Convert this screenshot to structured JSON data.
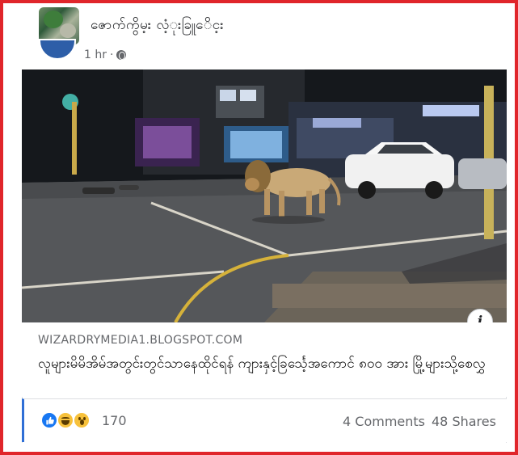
{
  "page": {
    "name": "ဇောက်ကွိမ့း လံ့ုးခြူေိင့း"
  },
  "post": {
    "time": "1 hr",
    "link_domain": "WIZARDRYMEDIA1.BLOGSPOT.COM",
    "link_headline": "လူများမိမိအိမ်အတွင်းတွင်သာနေထိုင်ရန် ကျားနှင့်ခြင်္သေ့အကောင် ၈၀၀ အား မြို့များသို့စေလွှ"
  },
  "reactions": {
    "icons": [
      "like-icon",
      "haha-icon",
      "wow-icon"
    ],
    "count": "170",
    "comments": "4 Comments",
    "shares": "48 Shares"
  },
  "colors": {
    "frame": "#e0262b",
    "like": "#1877f2",
    "emoji": "#f7c13b",
    "accent_bar": "#2f6fd6"
  }
}
